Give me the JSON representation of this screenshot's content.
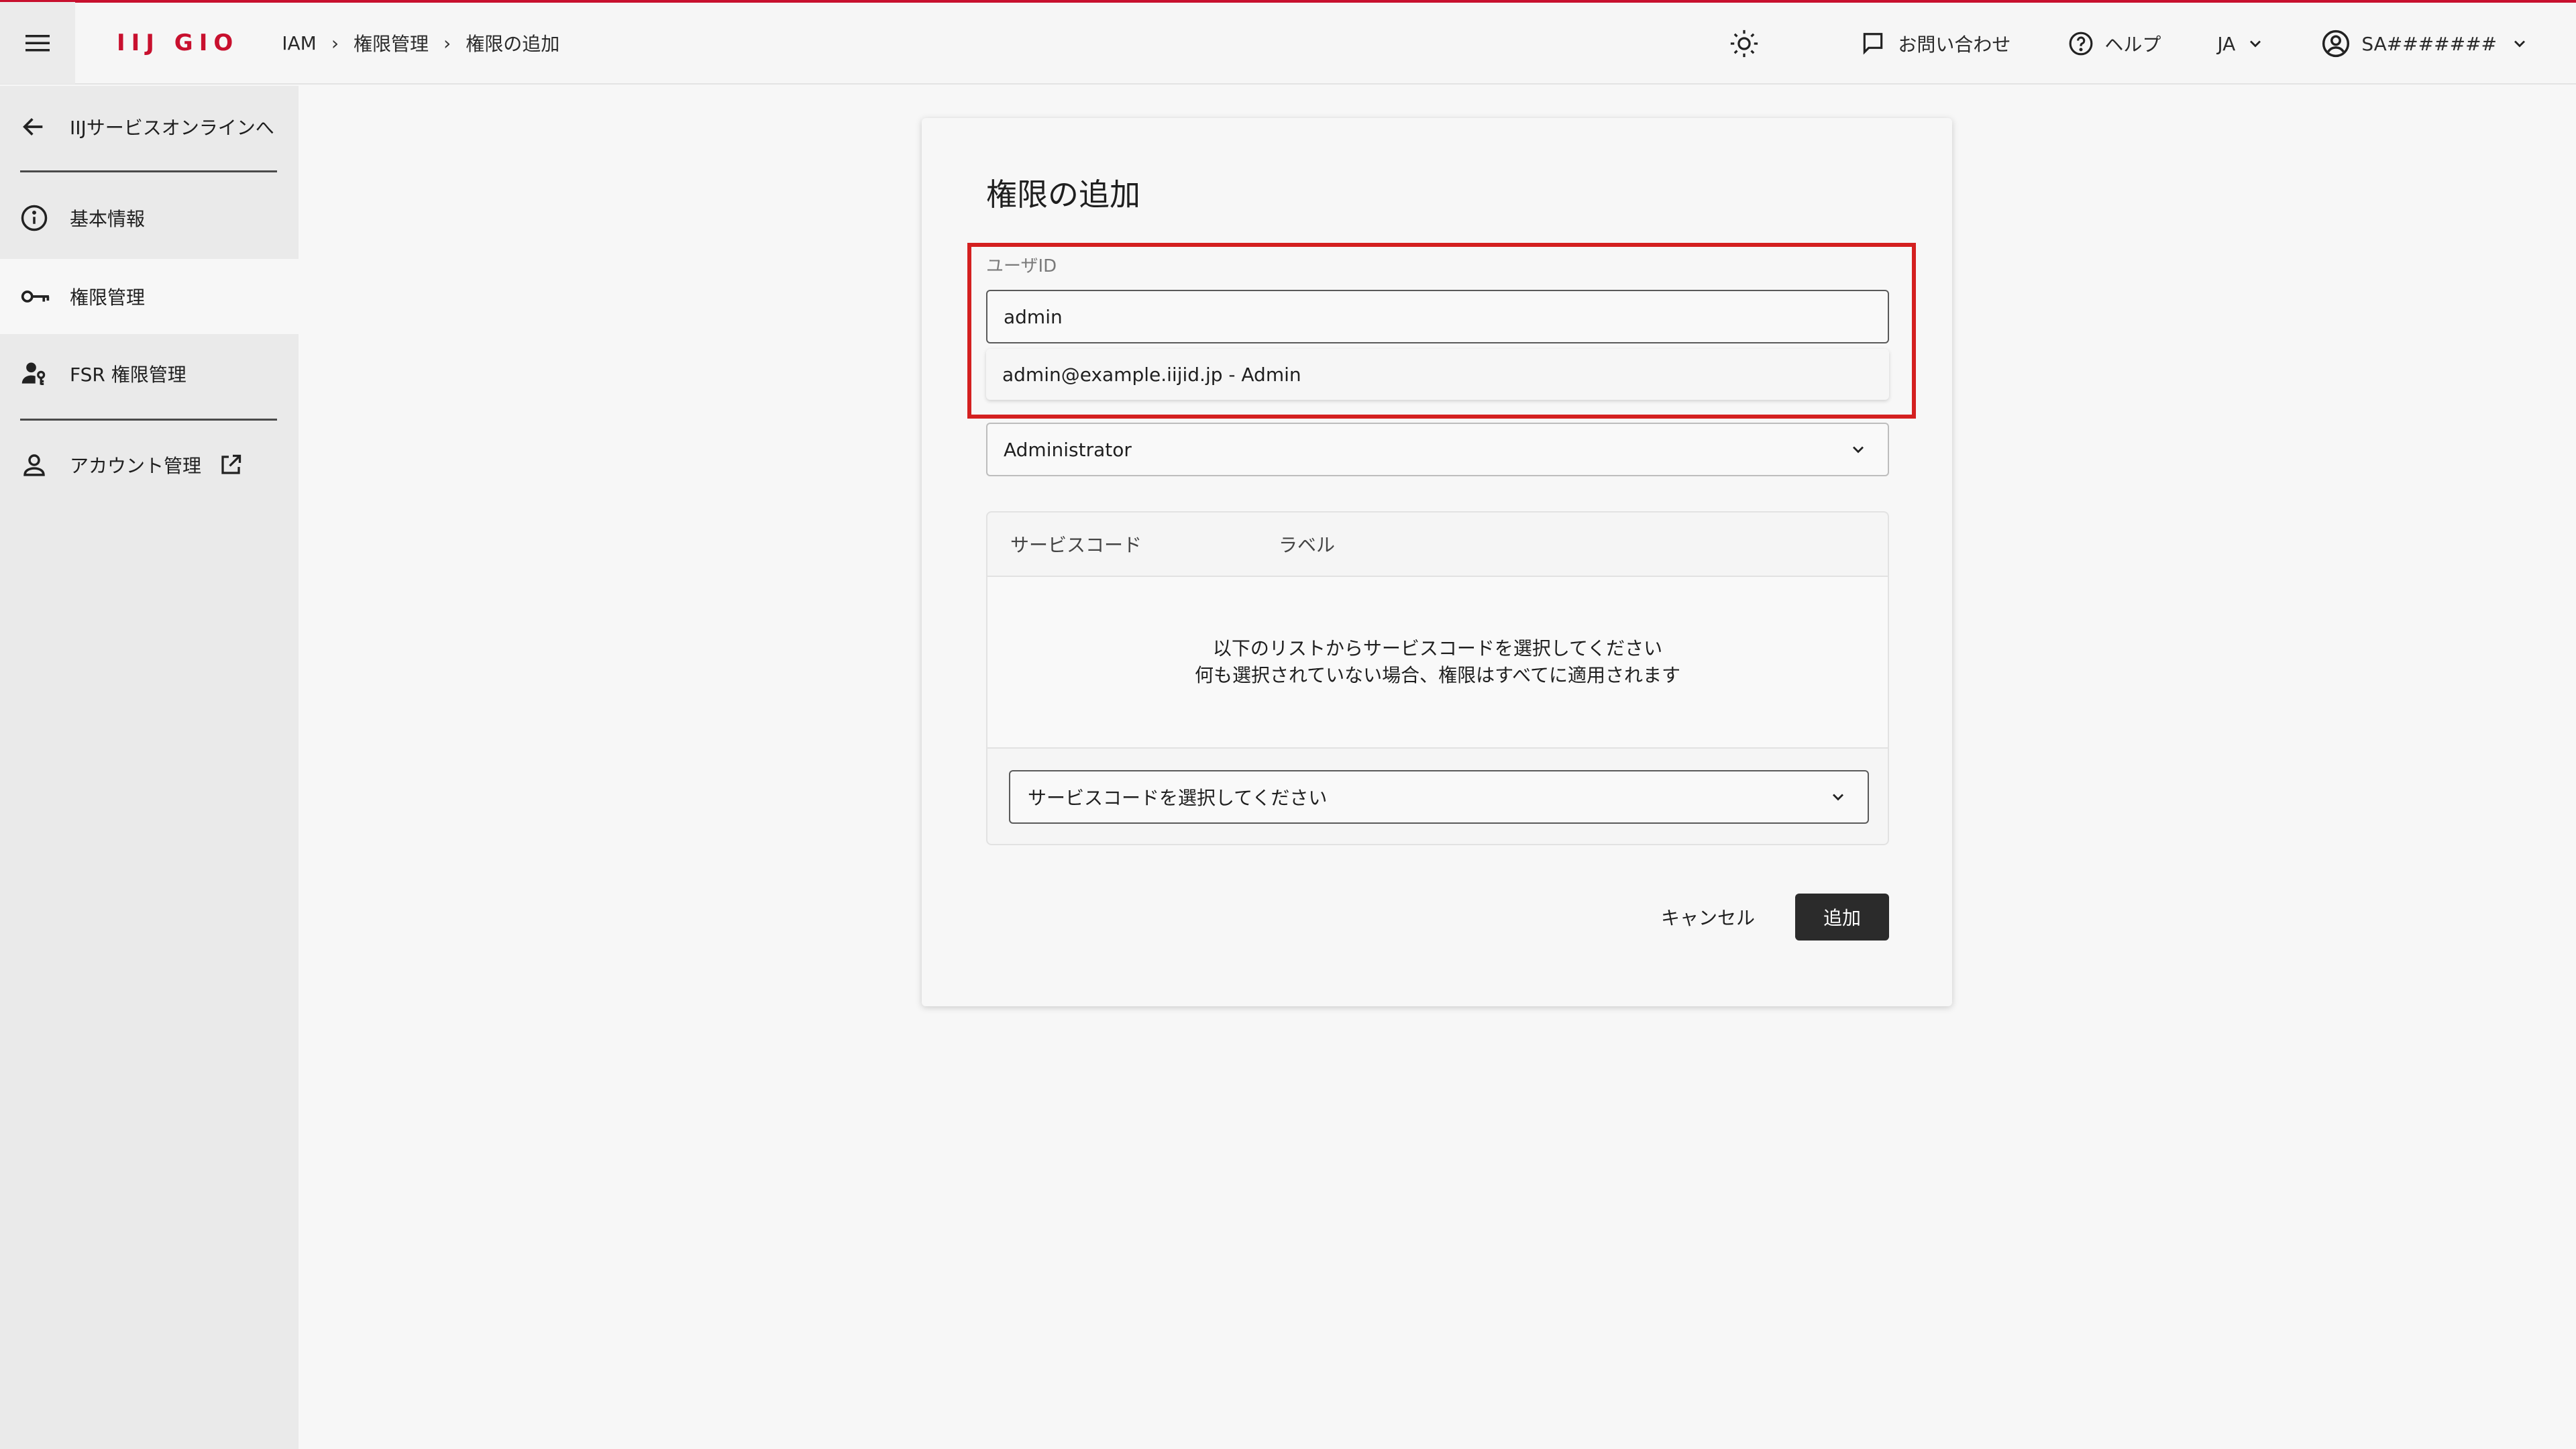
{
  "header": {
    "brand": "IIJ GIO",
    "breadcrumb": [
      "IAM",
      "権限管理",
      "権限の追加"
    ],
    "contact_label": "お問い合わせ",
    "help_label": "ヘルプ",
    "language": "JA",
    "account": "SA#######"
  },
  "sidebar": {
    "back_label": "IIJサービスオンラインへ",
    "items": [
      {
        "label": "基本情報"
      },
      {
        "label": "権限管理"
      },
      {
        "label": "FSR 権限管理"
      },
      {
        "label": "アカウント管理"
      }
    ]
  },
  "form": {
    "title": "権限の追加",
    "user_id_label": "ユーザID",
    "user_id_value": "admin",
    "suggestion": "admin@example.iijid.jp - Admin",
    "role_value": "Administrator",
    "service_table": {
      "col_service_code": "サービスコード",
      "col_label": "ラベル",
      "empty_line1": "以下のリストからサービスコードを選択してください",
      "empty_line2": "何も選択されていない場合、権限はすべてに適用されます"
    },
    "service_select_placeholder": "サービスコードを選択してください",
    "cancel_label": "キャンセル",
    "add_label": "追加"
  },
  "colors": {
    "brand_red": "#c8102e",
    "highlight_red": "#d42020",
    "primary_button": "#2b2b2b"
  }
}
